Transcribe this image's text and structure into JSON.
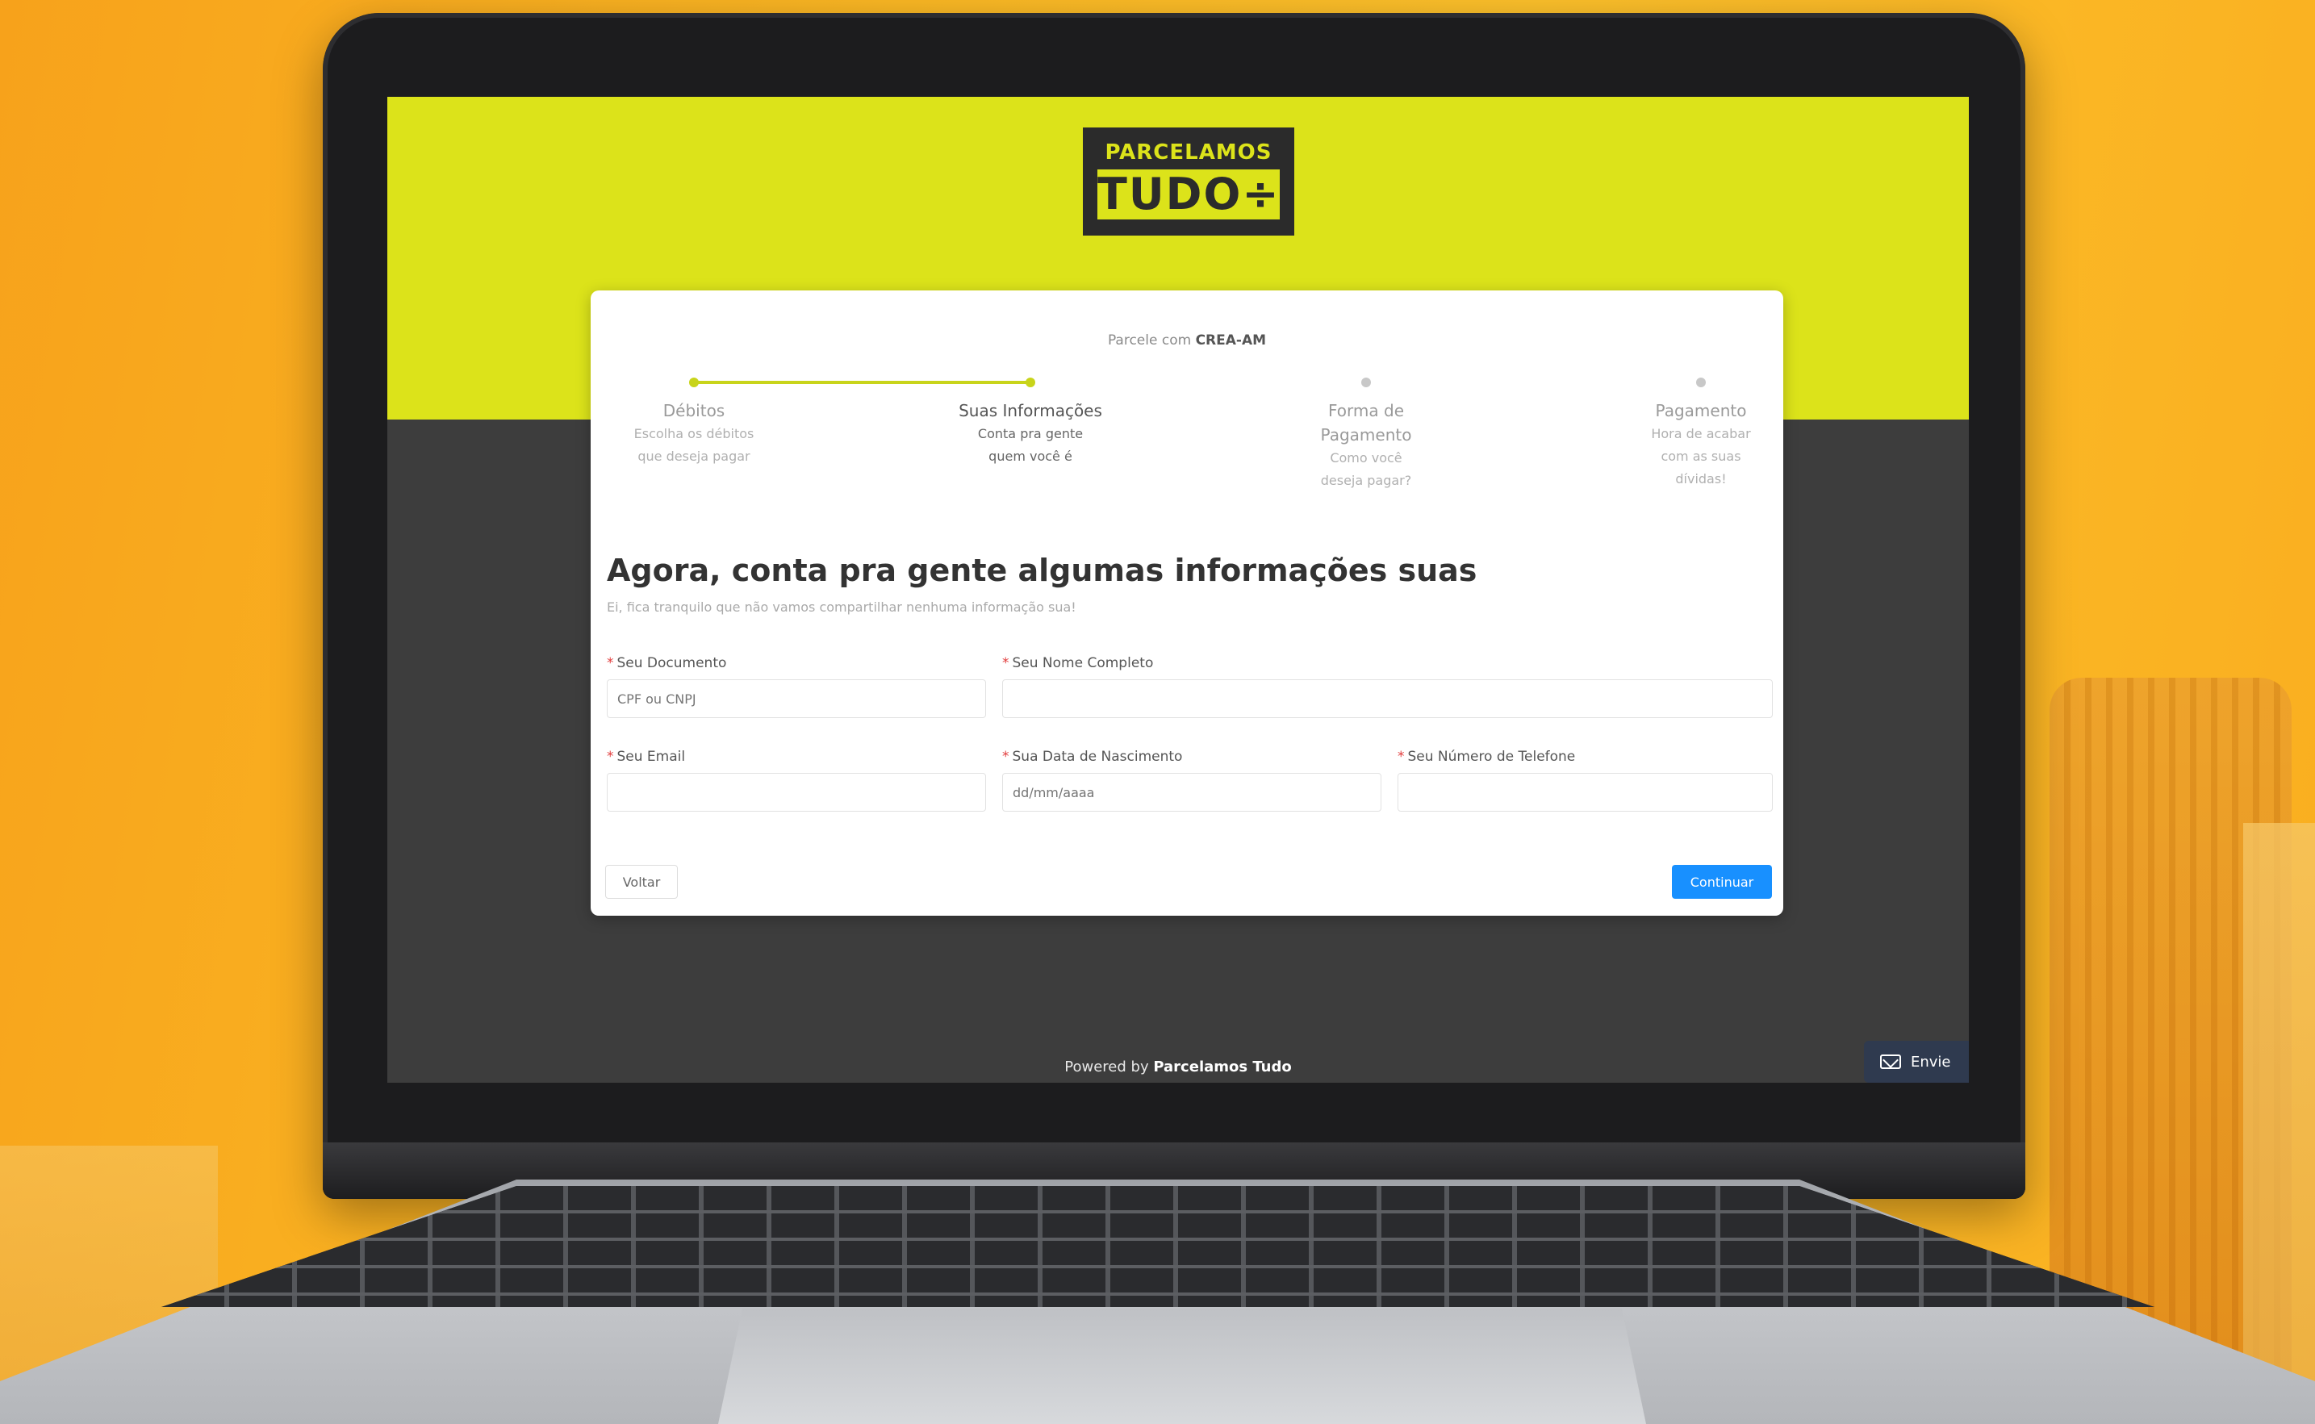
{
  "logo": {
    "line1": "PARCELAMOS",
    "line2": "TUDO÷"
  },
  "card": {
    "subtitle_prefix": "Parcele com",
    "subtitle_org": "CREA-AM",
    "steps": [
      {
        "title": "Débitos",
        "desc": "Escolha os débitos que deseja pagar",
        "state": "done"
      },
      {
        "title": "Suas Informações",
        "desc": "Conta pra gente quem você é",
        "state": "active"
      },
      {
        "title": "Forma de Pagamento",
        "desc": "Como você deseja pagar?",
        "state": "pending"
      },
      {
        "title": "Pagamento",
        "desc": "Hora de acabar com as suas dívidas!",
        "state": "pending"
      }
    ],
    "heading": "Agora, conta pra gente algumas informações suas",
    "note": "Ei, fica tranquilo que não vamos compartilhar nenhuma informação sua!",
    "fields": {
      "document": {
        "label": "Seu Documento",
        "placeholder": "CPF ou CNPJ",
        "value": ""
      },
      "name": {
        "label": "Seu Nome Completo",
        "placeholder": "",
        "value": ""
      },
      "email": {
        "label": "Seu Email",
        "placeholder": "",
        "value": ""
      },
      "birth": {
        "label": "Sua Data de Nascimento",
        "placeholder": "dd/mm/aaaa",
        "value": ""
      },
      "phone": {
        "label": "Seu Número de Telefone",
        "placeholder": "",
        "value": ""
      }
    },
    "back_label": "Voltar",
    "next_label": "Continuar"
  },
  "footer": {
    "powered_prefix": "Powered by",
    "powered_brand": "Parcelamos Tudo"
  },
  "feedback": {
    "label": "Envie"
  },
  "colors": {
    "accent": "#dce31a",
    "primary_button": "#1890ff",
    "required": "#e23c3c",
    "background": "#fbb824"
  }
}
